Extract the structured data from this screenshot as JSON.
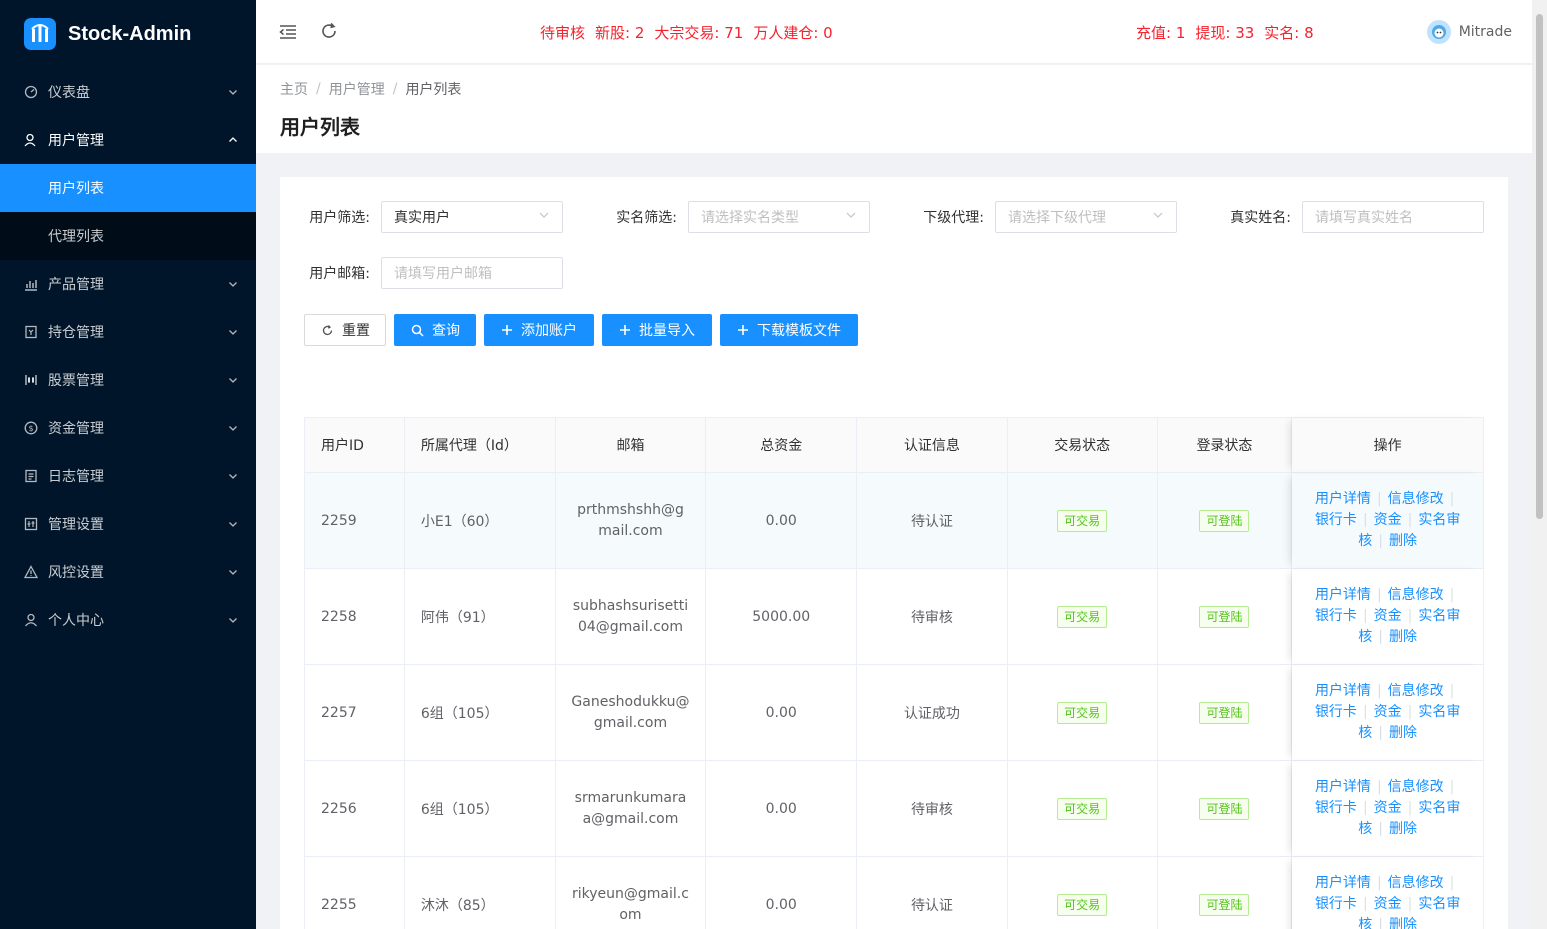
{
  "app": {
    "title": "Stock-Admin"
  },
  "sidebar": {
    "items": [
      {
        "label": "仪表盘",
        "icon": "dashboard-icon"
      },
      {
        "label": "用户管理",
        "icon": "user-manage-icon"
      },
      {
        "label": "产品管理",
        "icon": "chart-icon"
      },
      {
        "label": "持仓管理",
        "icon": "position-icon"
      },
      {
        "label": "股票管理",
        "icon": "stock-icon"
      },
      {
        "label": "资金管理",
        "icon": "money-icon"
      },
      {
        "label": "日志管理",
        "icon": "log-icon"
      },
      {
        "label": "管理设置",
        "icon": "settings-icon"
      },
      {
        "label": "风控设置",
        "icon": "warning-icon"
      },
      {
        "label": "个人中心",
        "icon": "person-icon"
      }
    ],
    "sub_items": [
      {
        "label": "用户列表"
      },
      {
        "label": "代理列表"
      }
    ]
  },
  "header": {
    "pending_label": "待审核",
    "new_stock": "新股: 2",
    "block_trade": "大宗交易: 71",
    "big_position": "万人建仓: 0",
    "recharge": "充值: 1",
    "withdraw": "提现: 33",
    "realname": "实名: 8",
    "user_name": "Mitrade"
  },
  "breadcrumb": [
    "主页",
    "用户管理",
    "用户列表"
  ],
  "page_title": "用户列表",
  "filters": {
    "user_filter_label": "用户筛选:",
    "user_filter_value": "真实用户",
    "realname_filter_label": "实名筛选:",
    "realname_filter_placeholder": "请选择实名类型",
    "agent_label": "下级代理:",
    "agent_placeholder": "请选择下级代理",
    "realname_input_label": "真实姓名:",
    "realname_input_placeholder": "请填写真实姓名",
    "email_label": "用户邮箱:",
    "email_placeholder": "请填写用户邮箱"
  },
  "buttons": {
    "reset": "重置",
    "query": "查询",
    "add_account": "添加账户",
    "batch_import": "批量导入",
    "download_template": "下载模板文件"
  },
  "table": {
    "headers": [
      "用户ID",
      "所属代理（Id）",
      "邮箱",
      "总资金",
      "认证信息",
      "交易状态",
      "登录状态",
      "操作"
    ],
    "rows": [
      {
        "id": "2259",
        "agent": "小E1（60）",
        "email": "prthmshshh@gmail.com",
        "funds": "0.00",
        "auth": "待认证",
        "trade": "可交易",
        "login": "可登陆"
      },
      {
        "id": "2258",
        "agent": "阿伟（91）",
        "email": "subhashsurisetti04@gmail.com",
        "funds": "5000.00",
        "auth": "待审核",
        "trade": "可交易",
        "login": "可登陆"
      },
      {
        "id": "2257",
        "agent": "6组（105）",
        "email": "Ganeshodukku@gmail.com",
        "funds": "0.00",
        "auth": "认证成功",
        "trade": "可交易",
        "login": "可登陆"
      },
      {
        "id": "2256",
        "agent": "6组（105）",
        "email": "srmarunkumaraa@gmail.com",
        "funds": "0.00",
        "auth": "待审核",
        "trade": "可交易",
        "login": "可登陆"
      },
      {
        "id": "2255",
        "agent": "沐沐（85）",
        "email": "rikyeun@gmail.com",
        "funds": "0.00",
        "auth": "待认证",
        "trade": "可交易",
        "login": "可登陆"
      }
    ],
    "ops": {
      "detail": "用户详情",
      "edit": "信息修改",
      "bank": "银行卡",
      "funds": "资金",
      "audit_a": "实名审",
      "audit_b": "核",
      "delete": "删除"
    }
  },
  "colors": {
    "sidebar_bg": "#001529",
    "primary": "#1890ff",
    "alert": "#f5222d",
    "success": "#52c41a"
  }
}
